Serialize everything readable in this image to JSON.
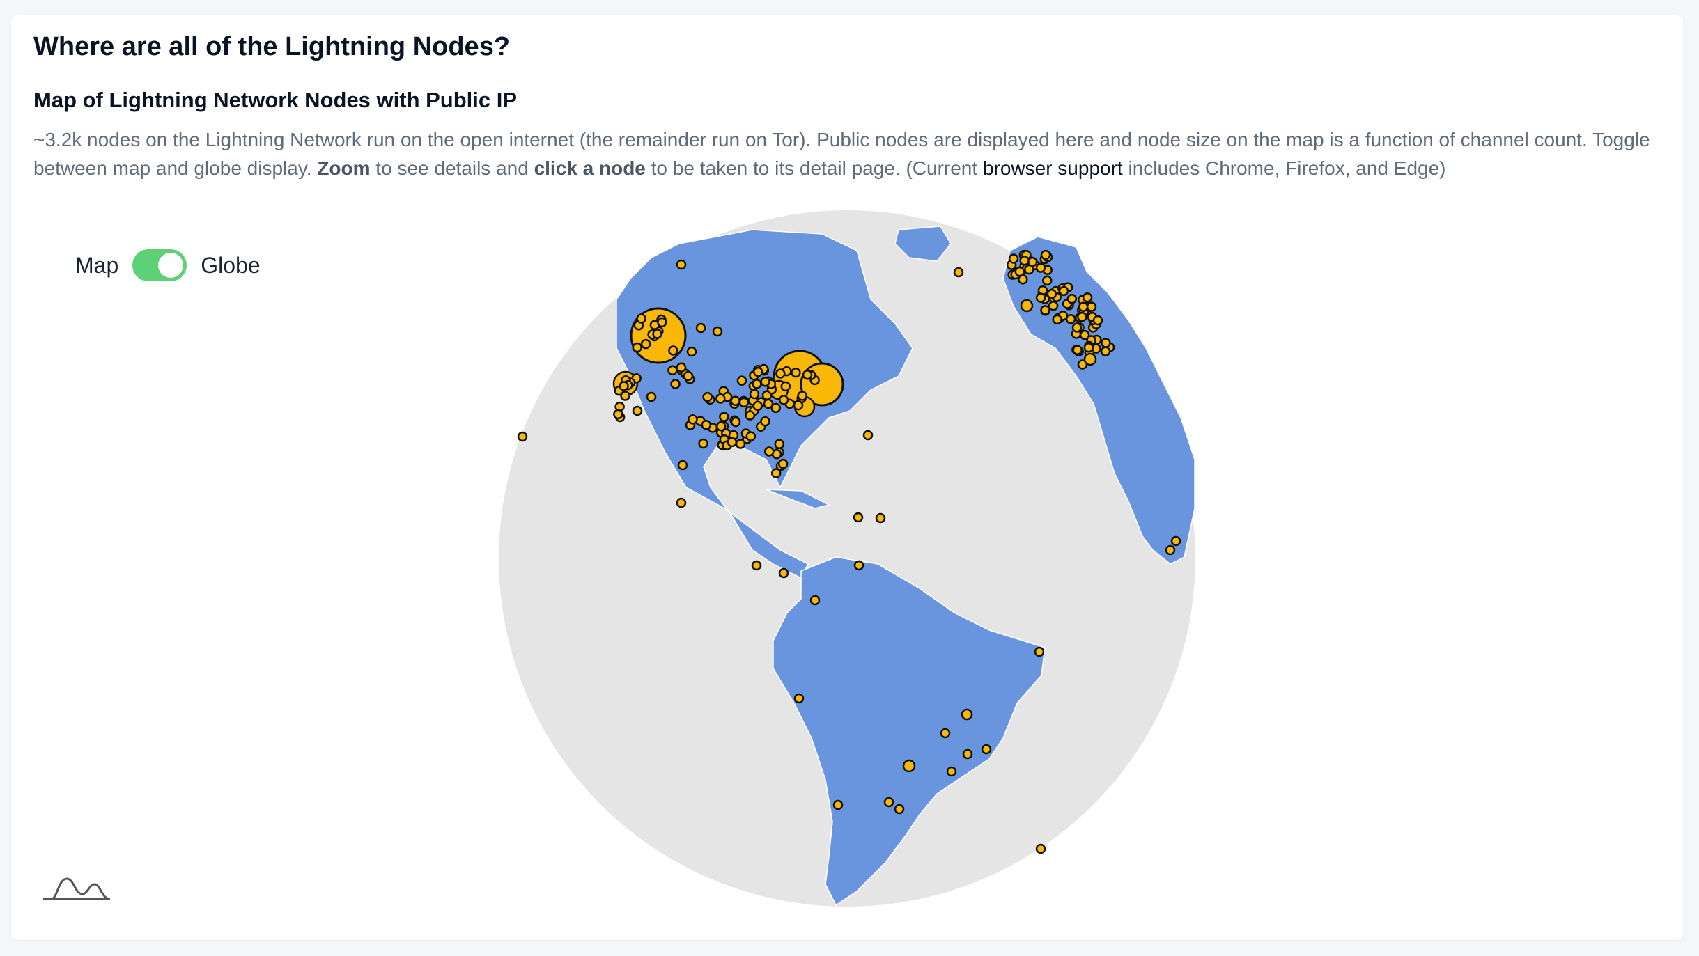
{
  "page": {
    "title": "Where are all of the Lightning Nodes?",
    "subtitle": "Map of Lightning Network Nodes with Public IP",
    "desc": {
      "p1": "~3.2k nodes on the Lightning Network run on the open internet (the remainder run on Tor). Public nodes are displayed here and node size on the map is a function of channel count. Toggle between map and globe display. ",
      "zoom": "Zoom",
      "p2": " to see details and ",
      "click": "click a node",
      "p3": " to be taken to its detail page. (Current ",
      "link": "browser support",
      "p4": " includes Chrome, Firefox, and Edge)"
    }
  },
  "toggle": {
    "left_label": "Map",
    "right_label": "Globe",
    "selected": "Globe",
    "color": "#5ed176"
  },
  "colors": {
    "ocean": "#e5e5e5",
    "land": "#6895de",
    "node_fill": "#f9b708",
    "node_stroke": "#111111"
  },
  "logo": {
    "icon": "logo-wave-icon"
  }
}
